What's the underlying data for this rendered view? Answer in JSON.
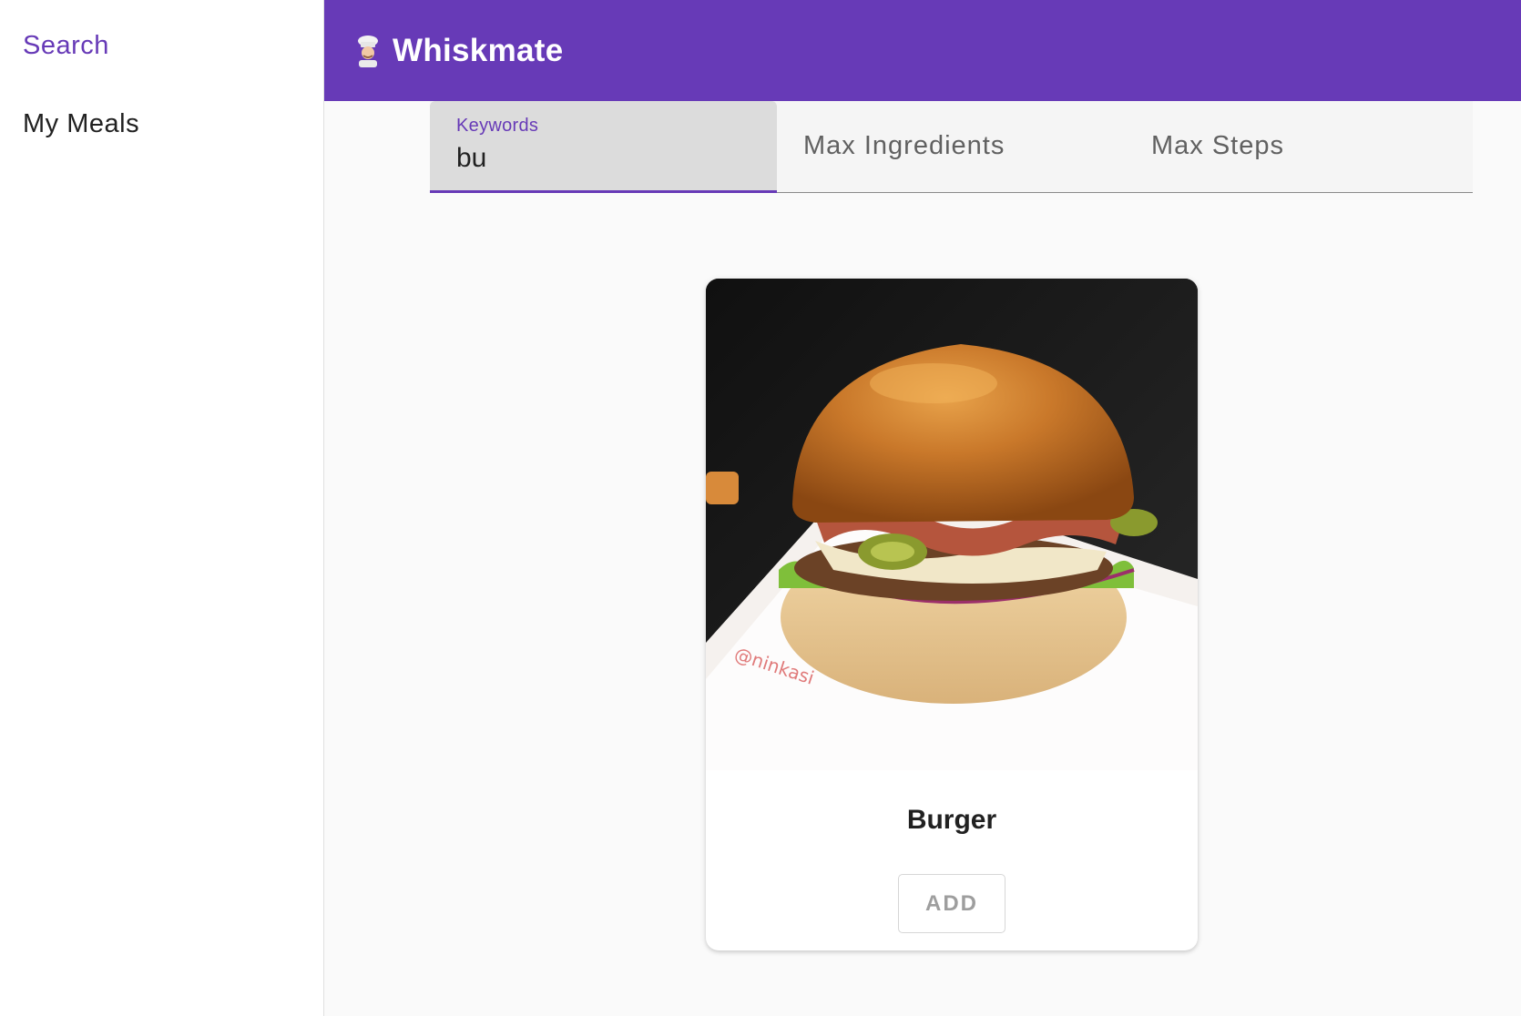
{
  "app": {
    "title": "Whiskmate",
    "logo_icon": "chef-icon",
    "accent_color": "#673ab7"
  },
  "sidebar": {
    "items": [
      {
        "label": "Search",
        "active": true
      },
      {
        "label": "My Meals",
        "active": false
      }
    ]
  },
  "filters": {
    "keywords": {
      "label": "Keywords",
      "value": "bu"
    },
    "max_ingredients": {
      "label": "Max Ingredients"
    },
    "max_steps": {
      "label": "Max Steps"
    }
  },
  "results": [
    {
      "name": "Burger",
      "image": "burger-photo",
      "image_watermark": "@ninkasi",
      "action_label": "ADD"
    }
  ]
}
